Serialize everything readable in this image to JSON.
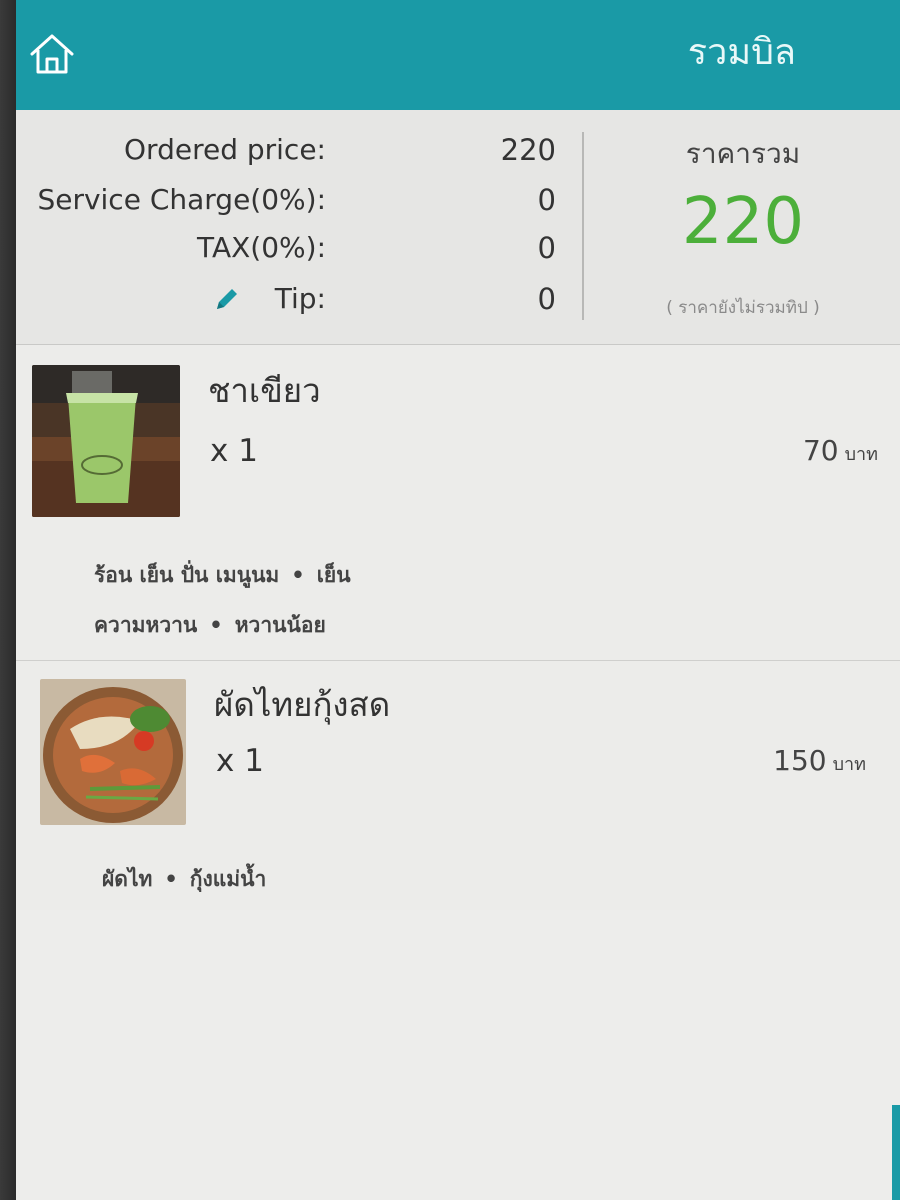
{
  "header": {
    "title": "รวมบิล",
    "home_icon": "home-icon",
    "background_color": "#1a9aa6"
  },
  "summary": {
    "rows": [
      {
        "label": "Ordered price:",
        "value": "220"
      },
      {
        "label": "Service Charge(0%):",
        "value": "0"
      },
      {
        "label": "TAX(0%):",
        "value": "0"
      },
      {
        "label": "Tip:",
        "value": "0",
        "icon": "pencil-icon"
      }
    ],
    "total_label": "ราคารวม",
    "total_value": "220",
    "total_color": "#4caf3a",
    "total_note": "( ราคายังไม่รวมทิป )"
  },
  "items": [
    {
      "name": "ชาเขียว",
      "qty": "x 1",
      "price": "70",
      "currency": "บาท",
      "image_icon": "green-tea-photo",
      "options": [
        {
          "group": "ร้อน เย็น ปั่น เมนูนม",
          "choice": "เย็น"
        },
        {
          "group": "ความหวาน",
          "choice": "หวานน้อย"
        }
      ]
    },
    {
      "name": "ผัดไทยกุ้งสด",
      "qty": "x 1",
      "price": "150",
      "currency": "บาท",
      "image_icon": "pad-thai-photo",
      "options": [
        {
          "group": "ผัดไท",
          "choice": "กุ้งแม่น้ำ"
        }
      ]
    }
  ],
  "separator": "•"
}
